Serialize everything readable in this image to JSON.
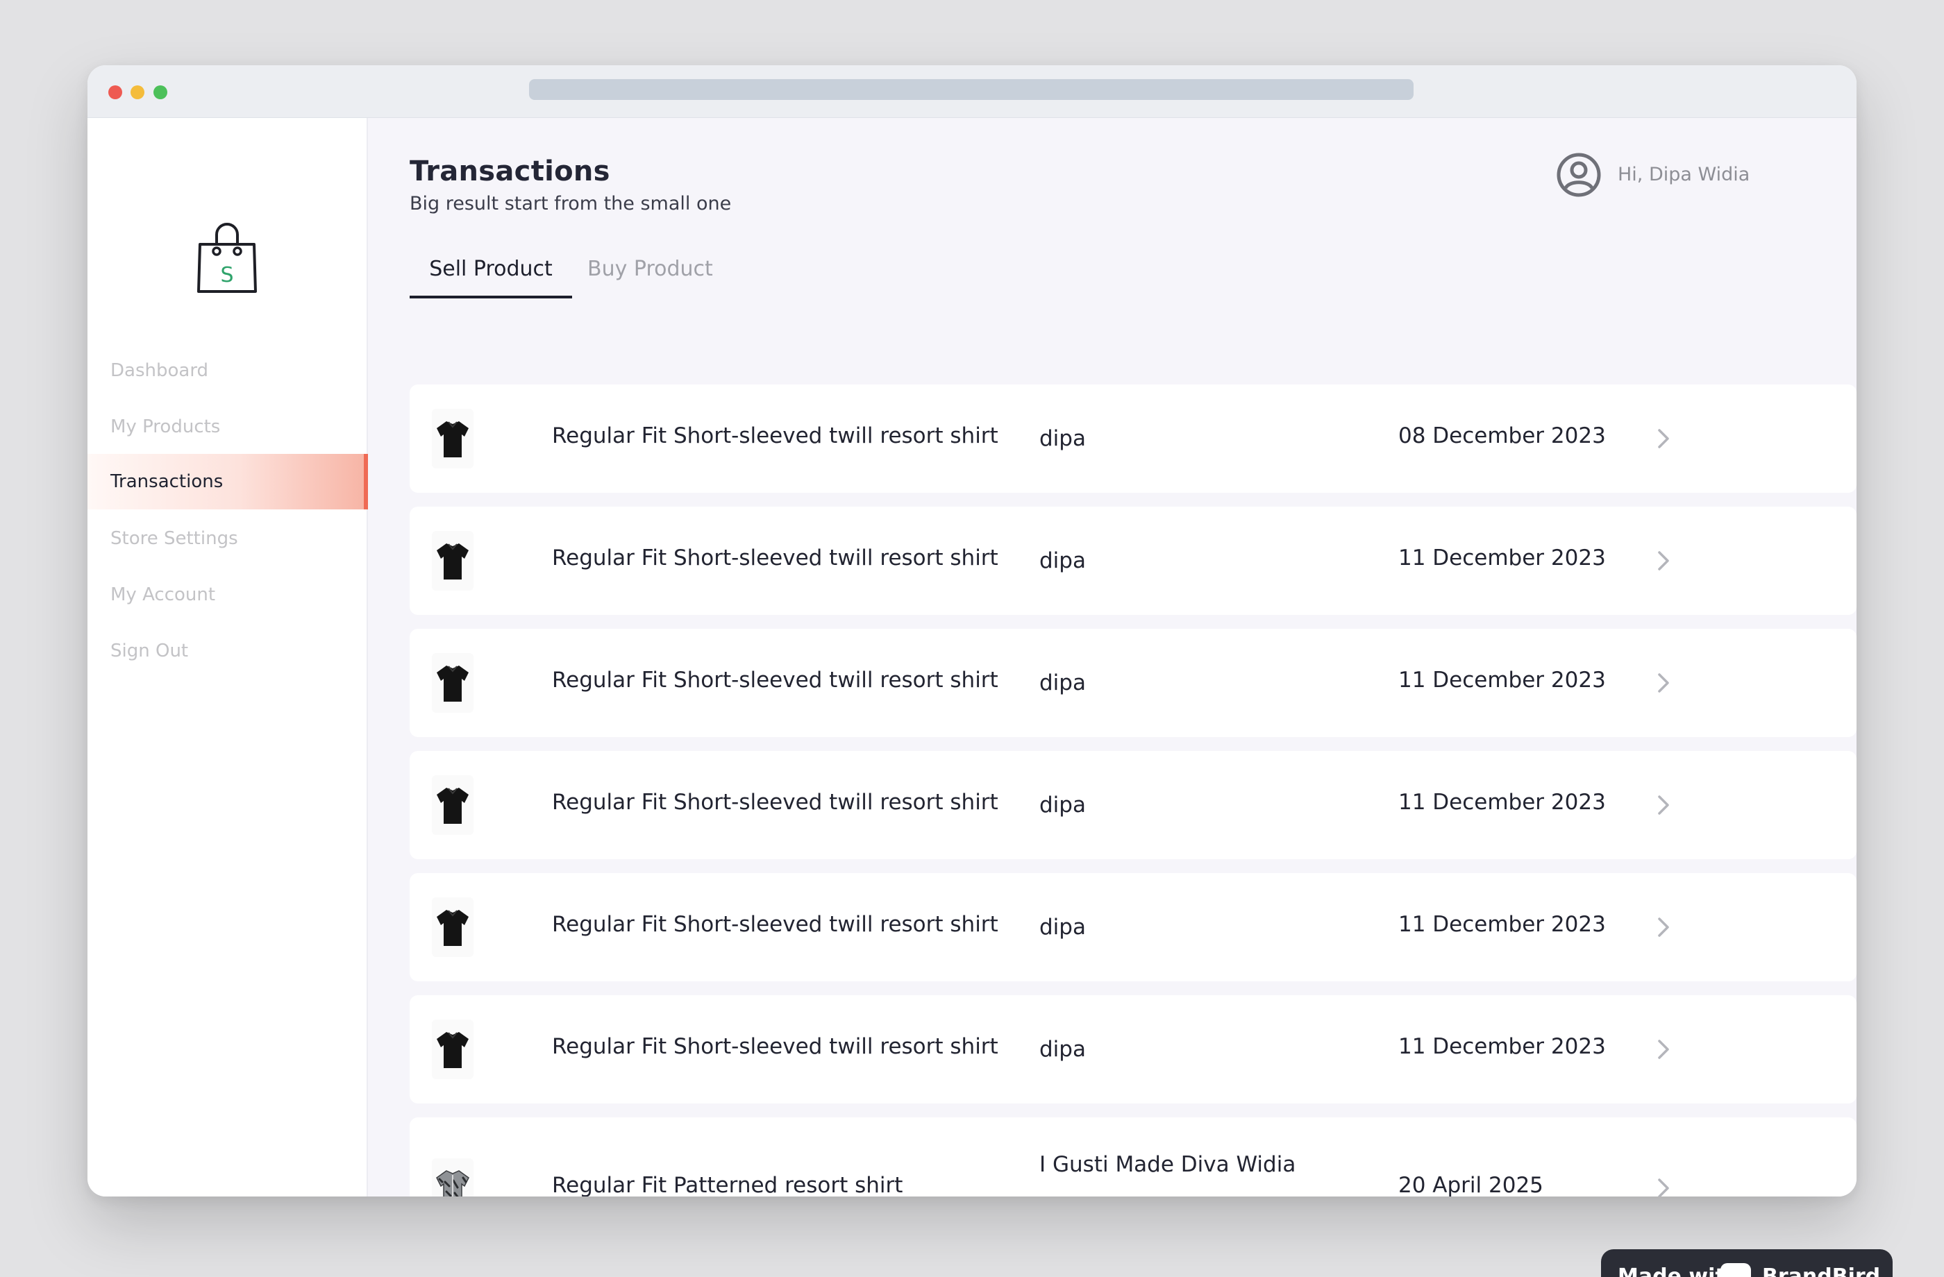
{
  "header": {
    "title": "Transactions",
    "subtitle": "Big result start from the small one",
    "greeting": "Hi, Dipa Widia"
  },
  "sidebar": {
    "logo_letter": "S",
    "items": [
      {
        "label": "Dashboard",
        "active": false
      },
      {
        "label": "My Products",
        "active": false
      },
      {
        "label": "Transactions",
        "active": true
      },
      {
        "label": "Store Settings",
        "active": false
      },
      {
        "label": "My Account",
        "active": false
      },
      {
        "label": "Sign Out",
        "active": false
      }
    ]
  },
  "tabs": [
    {
      "label": "Sell Product",
      "active": true
    },
    {
      "label": "Buy Product",
      "active": false
    }
  ],
  "transactions": [
    {
      "product": "Regular Fit Short-sleeved twill resort shirt",
      "buyer": "dipa",
      "date": "08 December 2023",
      "thumb_icon": "black-shirt-icon"
    },
    {
      "product": "Regular Fit Short-sleeved twill resort shirt",
      "buyer": "dipa",
      "date": "11 December 2023",
      "thumb_icon": "black-shirt-icon"
    },
    {
      "product": "Regular Fit Short-sleeved twill resort shirt",
      "buyer": "dipa",
      "date": "11 December 2023",
      "thumb_icon": "black-shirt-icon"
    },
    {
      "product": "Regular Fit Short-sleeved twill resort shirt",
      "buyer": "dipa",
      "date": "11 December 2023",
      "thumb_icon": "black-shirt-icon"
    },
    {
      "product": "Regular Fit Short-sleeved twill resort shirt",
      "buyer": "dipa",
      "date": "11 December 2023",
      "thumb_icon": "black-shirt-icon"
    },
    {
      "product": "Regular Fit Short-sleeved twill resort shirt",
      "buyer": "dipa",
      "date": "11 December 2023",
      "thumb_icon": "black-shirt-icon"
    },
    {
      "product": "Regular Fit Patterned resort shirt",
      "buyer": "I Gusti Made Diva Widia Wiartha",
      "date": "20 April 2025",
      "thumb_icon": "patterned-shirt-icon"
    }
  ],
  "badge": {
    "text": "Made with",
    "brand": "BrandBird"
  },
  "colors": {
    "accent": "#ef6a55",
    "logo_letter": "#2fa36b",
    "cart": "#ef7360",
    "page_bg": "#f6f5fa"
  }
}
